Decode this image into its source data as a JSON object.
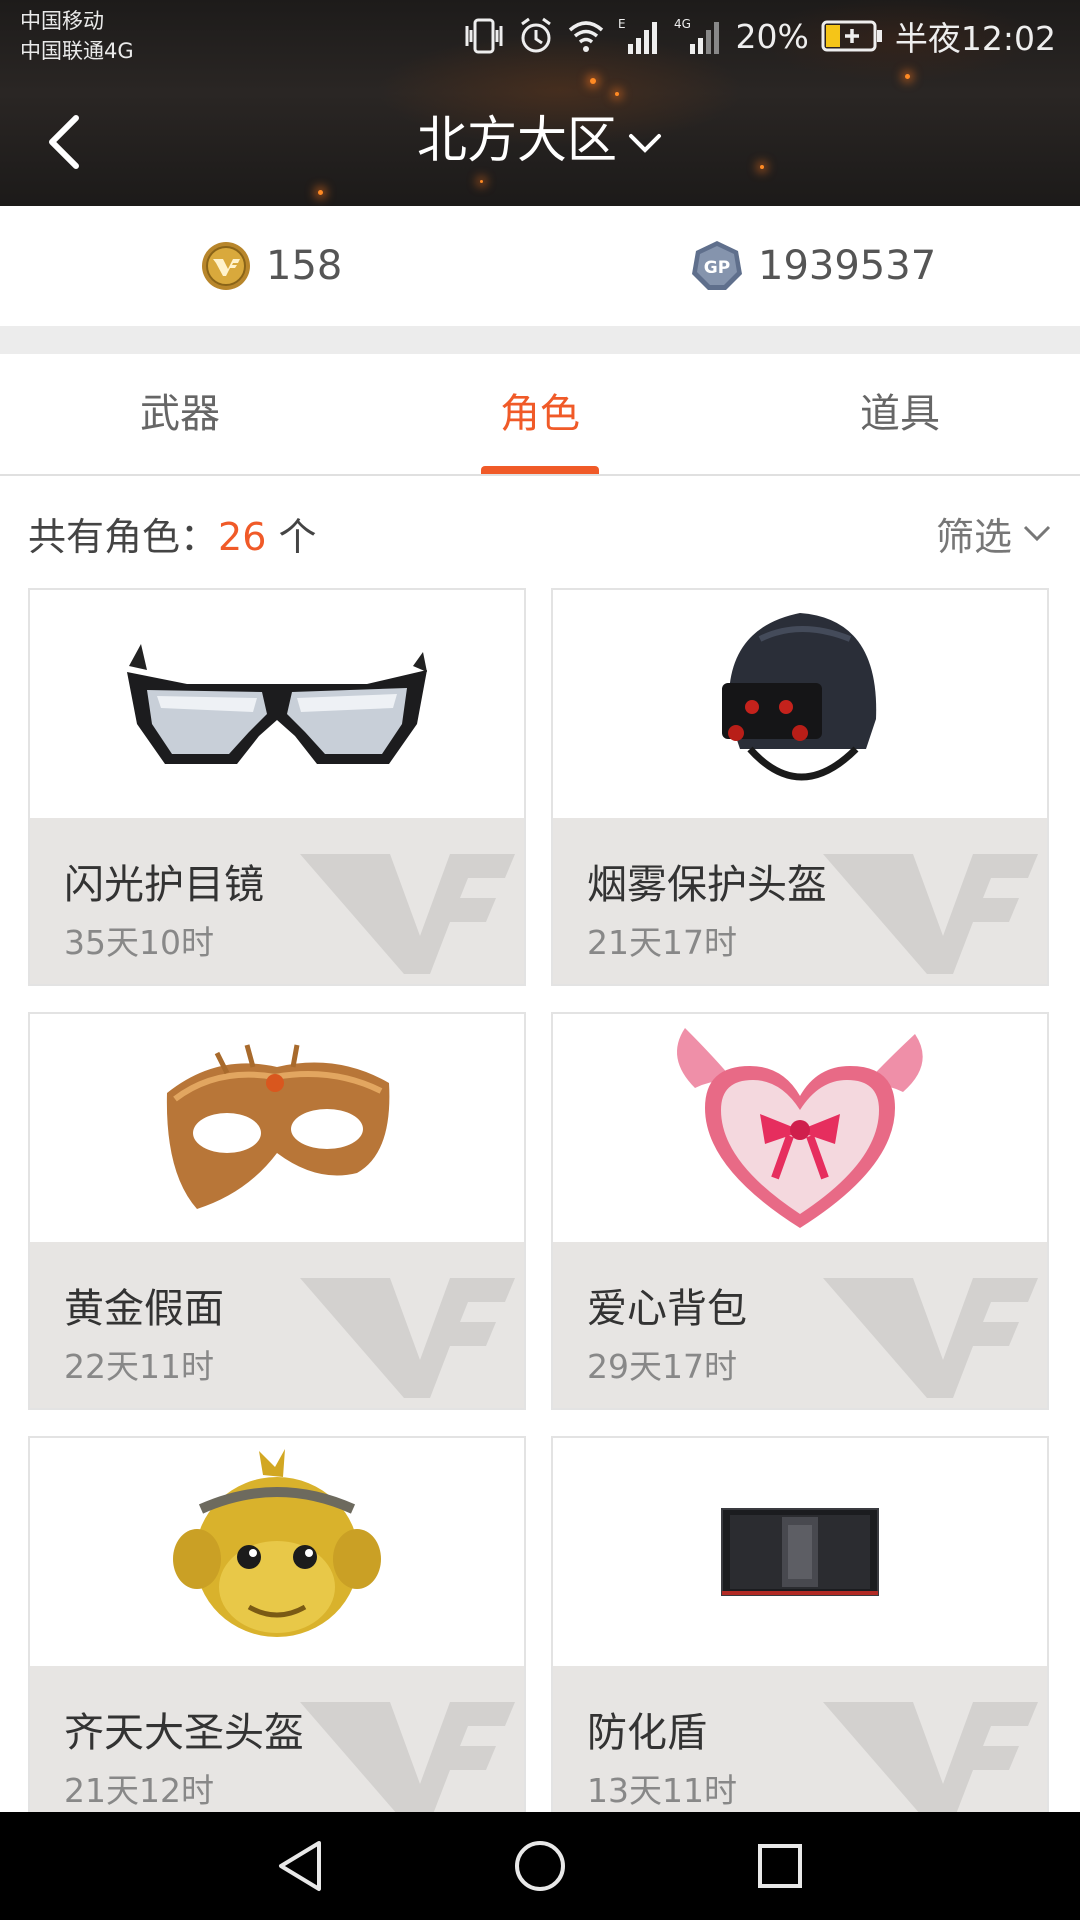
{
  "status_bar": {
    "carrier_1": "中国移动",
    "carrier_2": "中国联通4G",
    "battery": "20%",
    "time": "半夜12:02",
    "icons": [
      "vibrate-icon",
      "alarm-icon",
      "wifi-icon",
      "signal-icon",
      "signal-4g-icon",
      "battery-icon"
    ]
  },
  "header": {
    "title": "北方大区",
    "back_icon": "back-arrow-icon",
    "dropdown_icon": "chevron-down-icon"
  },
  "currency": {
    "cf_points": "158",
    "gp": "1939537",
    "gp_badge": "GP",
    "icons": [
      "cf-coin-icon",
      "gp-coin-icon"
    ]
  },
  "tabs": [
    {
      "label": "武器",
      "active": false
    },
    {
      "label": "角色",
      "active": true
    },
    {
      "label": "道具",
      "active": false
    }
  ],
  "summary": {
    "prefix": "共有角色：",
    "count": "26",
    "suffix": " 个",
    "filter_label": "筛选"
  },
  "items": [
    {
      "name": "闪光护目镜",
      "time": "35天10时",
      "icon": "goggles-image"
    },
    {
      "name": "烟雾保护头盔",
      "time": "21天17时",
      "icon": "helmet-image"
    },
    {
      "name": "黄金假面",
      "time": "22天11时",
      "icon": "gold-mask-image"
    },
    {
      "name": "爱心背包",
      "time": "29天17时",
      "icon": "heart-backpack-image"
    },
    {
      "name": "齐天大圣头盔",
      "time": "21天12时",
      "icon": "monkey-king-helmet-image"
    },
    {
      "name": "防化盾",
      "time": "13天11时",
      "icon": "chemical-shield-image"
    }
  ],
  "colors": {
    "accent": "#f05a28",
    "card_info_bg": "#e7e5e3",
    "header_bg": "#222020"
  },
  "nav": [
    "nav-back-icon",
    "nav-home-icon",
    "nav-recents-icon"
  ]
}
